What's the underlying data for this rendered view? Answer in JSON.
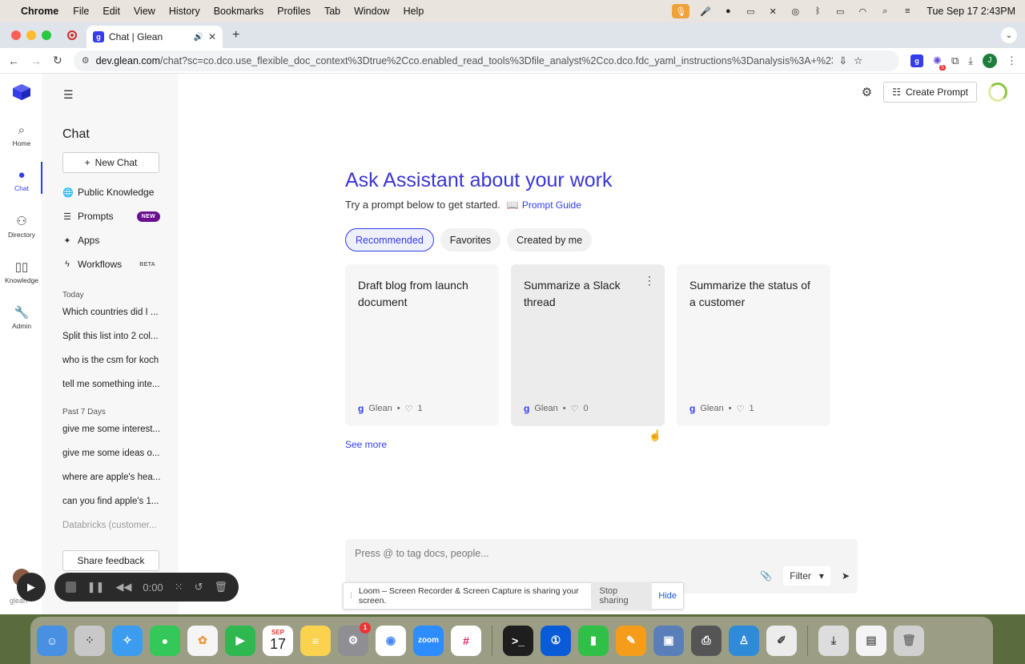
{
  "menubar": {
    "app": "Chrome",
    "items": [
      "File",
      "Edit",
      "View",
      "History",
      "Bookmarks",
      "Profiles",
      "Tab",
      "Window",
      "Help"
    ],
    "clock": "Tue Sep 17  2:43PM"
  },
  "browser": {
    "tab_title": "Chat | Glean",
    "url_host": "dev.glean.com",
    "url_path": "/chat?sc=co.dco.use_flexible_doc_context%3Dtrue%2Cco.enabled_read_tools%3Dfile_analyst%2Cco.dco.fdc_yaml_instructions%3Danalysis%3A+%23+In+at+most+2...",
    "profile_initial": "J",
    "ext_badge": "5"
  },
  "rail": {
    "items": [
      {
        "label": "Home"
      },
      {
        "label": "Chat"
      },
      {
        "label": "Directory"
      },
      {
        "label": "Knowledge"
      },
      {
        "label": "Admin"
      }
    ]
  },
  "sidebar": {
    "title": "Chat",
    "new_chat": "New Chat",
    "nav": [
      {
        "label": "Public Knowledge",
        "badge": ""
      },
      {
        "label": "Prompts",
        "badge": "NEW"
      },
      {
        "label": "Apps",
        "badge": ""
      },
      {
        "label": "Workflows",
        "badge": "BETA"
      }
    ],
    "today_label": "Today",
    "today": [
      "Which countries did I ...",
      "Split this list into 2 col...",
      "who is the csm for koch",
      "tell me something inte..."
    ],
    "past_label": "Past 7 Days",
    "past": [
      "give me some interest...",
      "give me some ideas o...",
      "where are apple's hea...",
      "can you find apple's 1...",
      "Databricks (customer..."
    ],
    "feedback": "Share feedback"
  },
  "header": {
    "create_prompt": "Create Prompt"
  },
  "main": {
    "title": "Ask Assistant about your work",
    "subtitle": "Try a prompt below to get started.",
    "guide": "Prompt Guide",
    "tabs": [
      "Recommended",
      "Favorites",
      "Created by me"
    ],
    "cards": [
      {
        "title": "Draft blog from launch document",
        "author": "Glean",
        "likes": "1"
      },
      {
        "title": "Summarize a Slack thread",
        "author": "Glean",
        "likes": "0"
      },
      {
        "title": "Summarize the status of a customer",
        "author": "Glean",
        "likes": "1"
      }
    ],
    "see_more": "See more",
    "composer_placeholder": "Press @ to tag docs, people...",
    "filter": "Filter"
  },
  "loom": {
    "message": "Loom – Screen Recorder & Screen Capture is sharing your screen.",
    "stop": "Stop sharing",
    "hide": "Hide",
    "timer": "0:00"
  },
  "dock": {
    "calendar_month": "SEP",
    "calendar_day": "17",
    "settings_badge": "1",
    "zoom_label": "zoom"
  },
  "colors": {
    "accent": "#343ced",
    "new_badge": "#6b0f91"
  }
}
